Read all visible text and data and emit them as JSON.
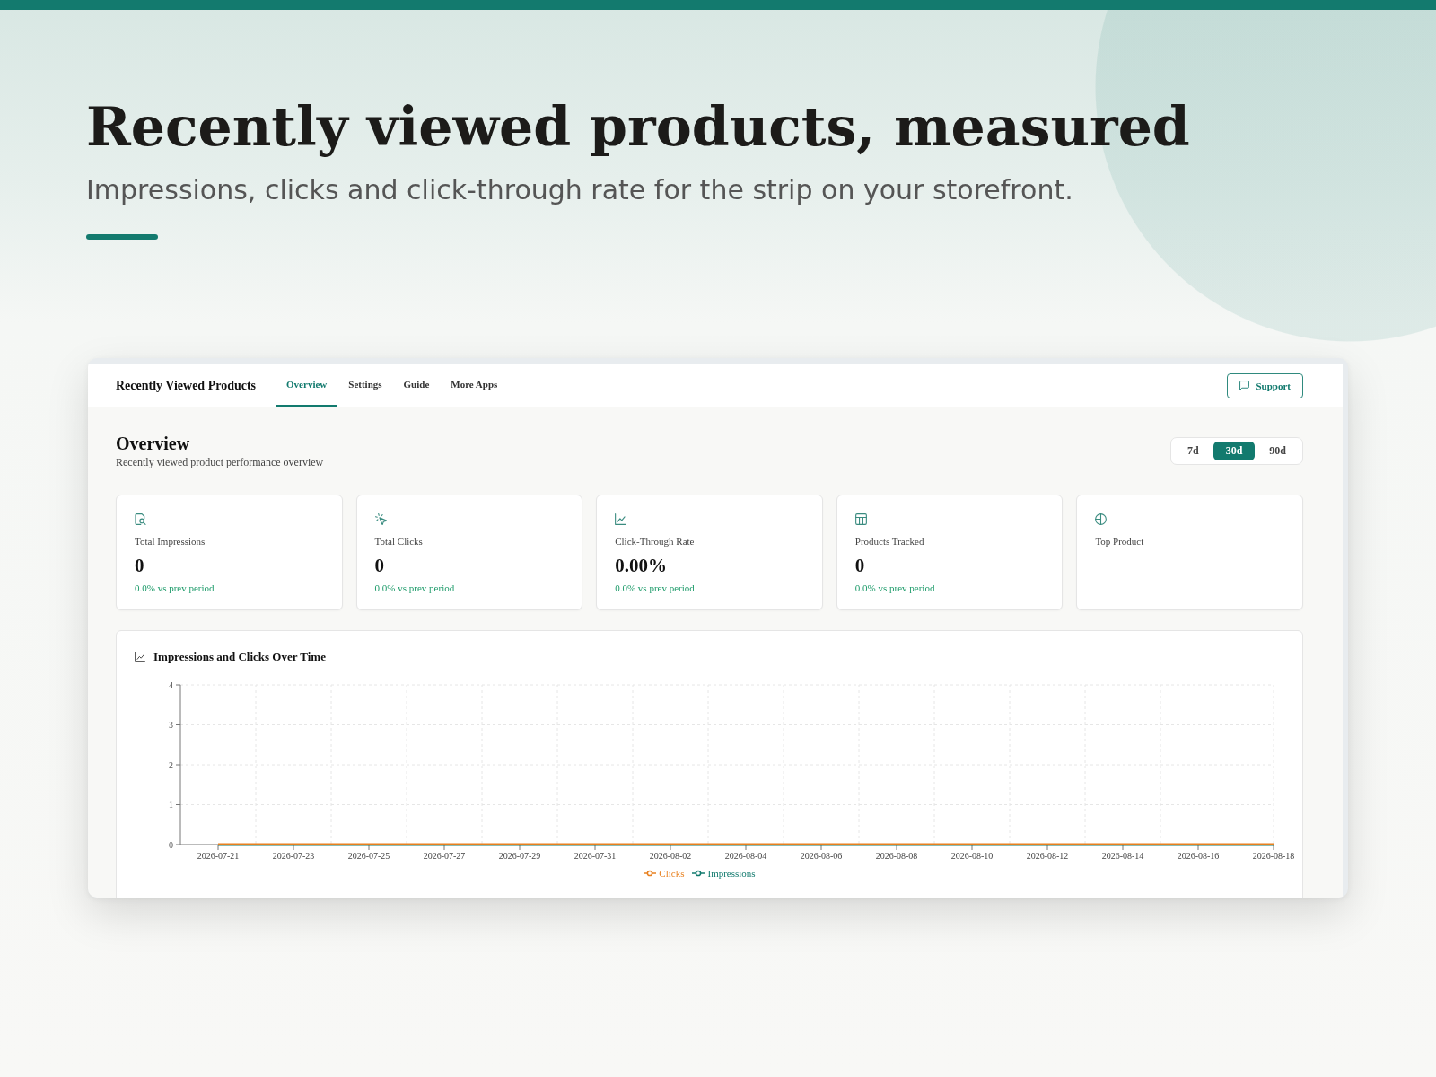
{
  "hero": {
    "title": "Recently viewed products, measured",
    "subtitle": "Impressions, clicks and click-through rate for the strip on your storefront."
  },
  "app": {
    "nav": {
      "brand": "Recently Viewed Products",
      "tabs": [
        {
          "label": "Overview",
          "selected": true
        },
        {
          "label": "Settings",
          "selected": false
        },
        {
          "label": "Guide",
          "selected": false
        },
        {
          "label": "More Apps",
          "selected": false
        }
      ],
      "support_button": "Support"
    },
    "header": {
      "title": "Overview",
      "subtitle": "Recently viewed product performance overview"
    },
    "range": [
      {
        "label": "7d",
        "selected": false
      },
      {
        "label": "30d",
        "selected": true
      },
      {
        "label": "90d",
        "selected": false
      }
    ],
    "metrics": [
      {
        "label": "Total Impressions",
        "value": "0",
        "change": "0.0% vs prev period"
      },
      {
        "label": "Total Clicks",
        "value": "0",
        "change": "0.0% vs prev period"
      },
      {
        "label": "Click-Through Rate",
        "value": "0.00%",
        "change": "0.0% vs prev period"
      },
      {
        "label": "Products Tracked",
        "value": "0",
        "change": "0.0% vs prev period"
      },
      {
        "label": "Top Product"
      }
    ],
    "chart": {
      "title": "Impressions and Clicks Over Time",
      "chart_data": {
        "type": "line",
        "categories": [
          "2026-07-21",
          "2026-07-23",
          "2026-07-25",
          "2026-07-27",
          "2026-07-29",
          "2026-07-31",
          "2026-08-02",
          "2026-08-04",
          "2026-08-06",
          "2026-08-08",
          "2026-08-10",
          "2026-08-12",
          "2026-08-14",
          "2026-08-16",
          "2026-08-18"
        ],
        "series": [
          {
            "name": "Clicks",
            "color": "#e8801f",
            "values": [
              0,
              0,
              0,
              0,
              0,
              0,
              0,
              0,
              0,
              0,
              0,
              0,
              0,
              0,
              0
            ]
          },
          {
            "name": "Impressions",
            "color": "#127a6e",
            "values": [
              0,
              0,
              0,
              0,
              0,
              0,
              0,
              0,
              0,
              0,
              0,
              0,
              0,
              0,
              0
            ]
          }
        ],
        "ylim": [
          0,
          4
        ],
        "yticks": [
          0,
          1,
          2,
          3,
          4
        ],
        "grid": true,
        "legend": "bottom"
      }
    }
  }
}
